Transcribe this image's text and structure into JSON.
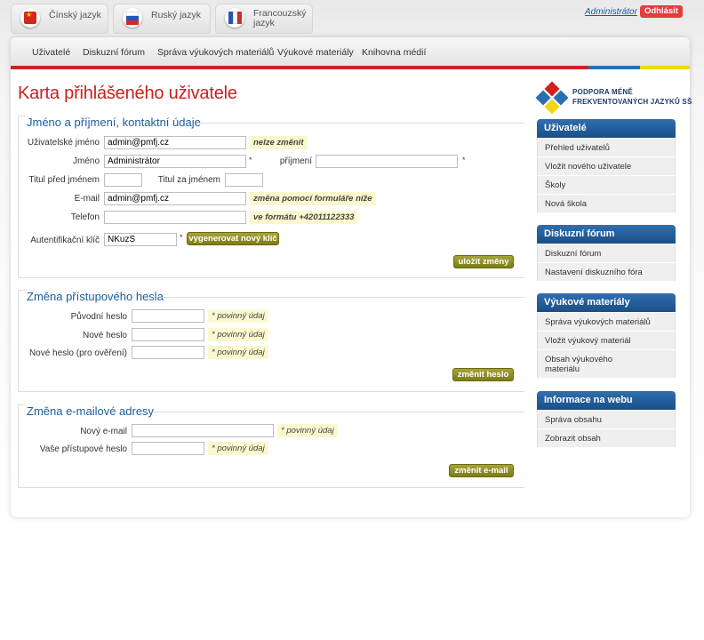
{
  "lang_tabs": [
    {
      "label": "Čínský jazyk"
    },
    {
      "label": "Ruský jazyk"
    },
    {
      "label": "Francouzský jazyk"
    }
  ],
  "user": {
    "name": "Administrátor",
    "logout": "Odhlásit"
  },
  "nav": [
    "Uživatelé",
    "Diskuzní fórum",
    "Správa výukových materiálů",
    "Výukové materiály",
    "Knihovna médií"
  ],
  "page_title": "Karta přihlášeného uživatele",
  "contact": {
    "title": "Jméno a příjmení, kontaktní údaje",
    "username_label": "Uživatelské jméno",
    "username": "admin@pmfj.cz",
    "username_hint": "nelze změnit",
    "firstname_label": "Jméno",
    "firstname": "Administrátor",
    "surname_label": "příjmení",
    "surname": "",
    "title_before_label": "Titul před jménem",
    "title_before": "",
    "title_after_label": "Titul za jménem",
    "title_after": "",
    "email_label": "E-mail",
    "email": "admin@pmfj.cz",
    "email_hint": "změna pomocí formuláře níže",
    "phone_label": "Telefon",
    "phone": "",
    "phone_hint": "ve formátu +42011122333",
    "auth_label": "Autentifikační klíč",
    "auth_key": "NKuzS",
    "generate_button": "vygenerovat nový klíč",
    "save_button": "uložit změny"
  },
  "password": {
    "title": "Změna přístupového hesla",
    "old_label": "Původní heslo",
    "new_label": "Nové heslo",
    "confirm_label": "Nové heslo (pro ověření)",
    "required": "povinný údaj",
    "button": "změnit heslo"
  },
  "email_change": {
    "title": "Změna e-mailové adresy",
    "new_label": "Nový e-mail",
    "password_label": "Vaše přístupové heslo",
    "required": "povinný údaj",
    "button": "změnit e-mail"
  },
  "logo": {
    "line1": "PODPORA MÉNĚ",
    "line2": "FREKVENTOVANÝCH JAZYKŮ SŠ"
  },
  "sidebar": [
    {
      "title": "Uživatelé",
      "items": [
        "Přehled uživatelů",
        "Vložit nového uživatele",
        "Školy",
        "Nová škola"
      ]
    },
    {
      "title": "Diskuzní fórum",
      "items": [
        "Diskuzní fórum",
        "Nastavení diskuzního fóra"
      ]
    },
    {
      "title": "Výukové materiály",
      "items": [
        "Správa výukových materiálů",
        "Vložit výukový materiál",
        "Obsah výukového materiálu"
      ]
    },
    {
      "title": "Informace na webu",
      "items": [
        "Správa obsahu",
        "Zobrazit obsah"
      ]
    }
  ],
  "colors": {
    "accent_red": "#d22020",
    "accent_blue": "#2a6db3",
    "accent_yellow": "#f2d516",
    "button_olive": "#8a8a22",
    "sidebar_blue": "#1f5590"
  }
}
